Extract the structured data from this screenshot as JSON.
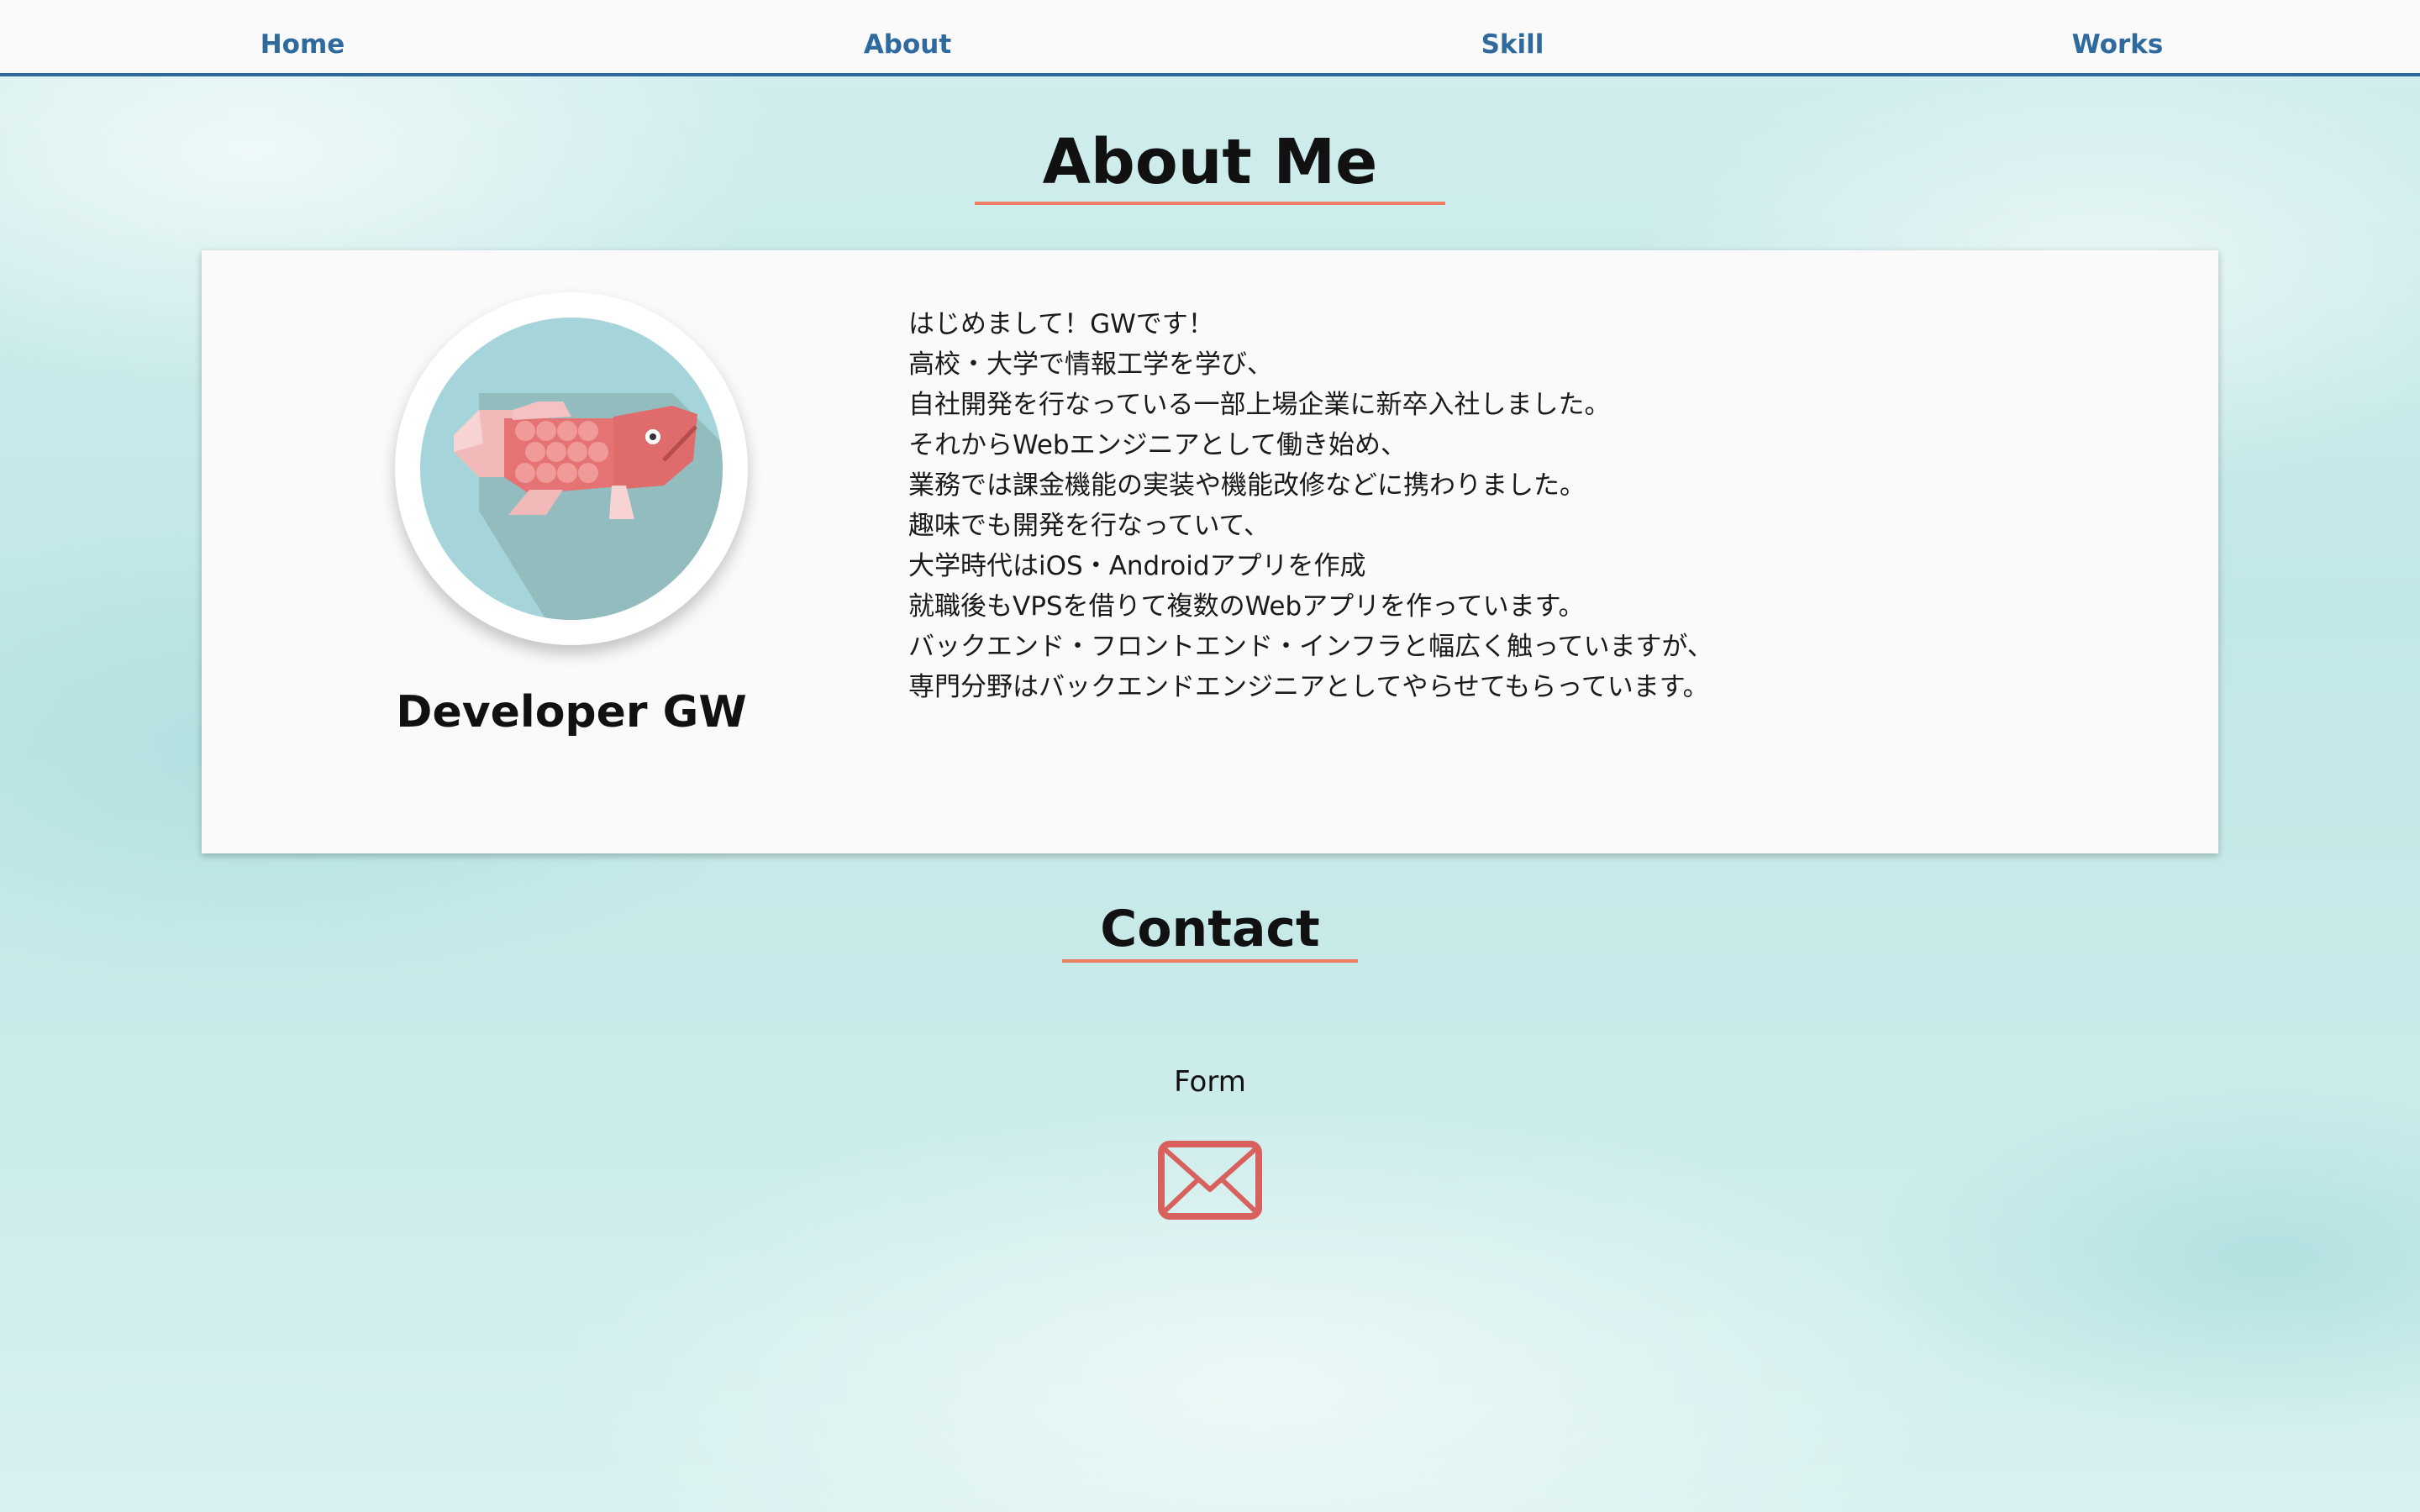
{
  "nav": {
    "items": [
      {
        "label": "Home"
      },
      {
        "label": "About"
      },
      {
        "label": "Skill"
      },
      {
        "label": "Works"
      }
    ]
  },
  "about": {
    "heading": "About Me",
    "name": "Developer GW",
    "avatar_icon": "koi-fish-icon",
    "bio_lines": [
      "はじめまして！GWです！",
      "高校・大学で情報工学を学び、",
      "自社開発を行なっている一部上場企業に新卒入社しました。",
      "それからWebエンジニアとして働き始め、",
      "業務では課金機能の実装や機能改修などに携わりました。",
      "趣味でも開発を行なっていて、",
      "大学時代はiOS・Androidアプリを作成",
      "就職後もVPSを借りて複数のWebアプリを作っています。",
      "バックエンド・フロントエンド・インフラと幅広く触っていますが、",
      "専門分野はバックエンドエンジニアとしてやらせてもらっています。"
    ]
  },
  "contact": {
    "heading": "Contact",
    "form_label": "Form",
    "mail_icon": "mail-icon"
  },
  "colors": {
    "nav_text": "#2f6a9e",
    "nav_border": "#2f6a9e",
    "heading_underline": "#ec7e63",
    "card_bg": "#fafafa",
    "mail_icon": "#d9615d",
    "avatar_bg": "#a5d4da",
    "fish": "#e06b6b"
  }
}
